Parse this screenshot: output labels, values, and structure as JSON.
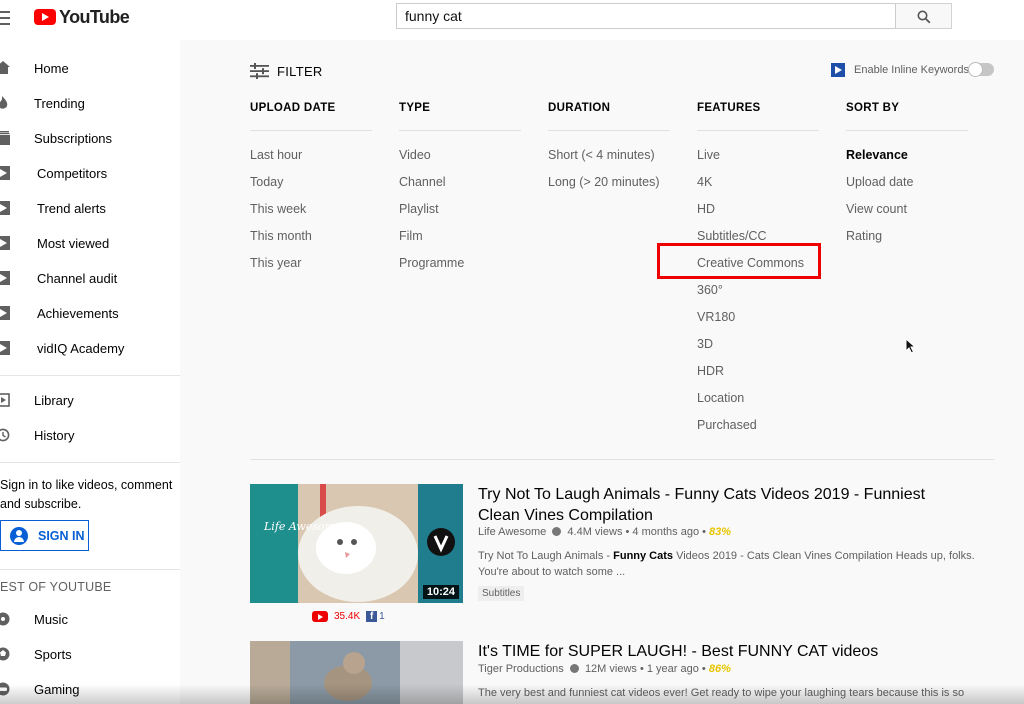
{
  "header": {
    "logo_text": "YouTube",
    "search_value": "funny cat"
  },
  "sidebar": {
    "items": [
      {
        "label": "Home",
        "icon": "home-icon"
      },
      {
        "label": "Trending",
        "icon": "flame-icon"
      },
      {
        "label": "Subscriptions",
        "icon": "subscriptions-icon"
      },
      {
        "label": "Competitors",
        "icon": "vidiq-play-icon"
      },
      {
        "label": "Trend alerts",
        "icon": "vidiq-play-icon"
      },
      {
        "label": "Most viewed",
        "icon": "vidiq-play-icon"
      },
      {
        "label": "Channel audit",
        "icon": "vidiq-play-icon"
      },
      {
        "label": "Achievements",
        "icon": "vidiq-play-icon"
      },
      {
        "label": "vidIQ Academy",
        "icon": "vidiq-play-icon"
      }
    ],
    "secondary": [
      {
        "label": "Library",
        "icon": "library-icon"
      },
      {
        "label": "History",
        "icon": "history-icon"
      }
    ],
    "signin_prompt": "Sign in to like videos, comment and subscribe.",
    "signin_label": "SIGN IN",
    "best_of_title": "EST OF YOUTUBE",
    "best_of": [
      {
        "label": "Music",
        "icon": "music-icon"
      },
      {
        "label": "Sports",
        "icon": "sports-icon"
      },
      {
        "label": "Gaming",
        "icon": "gaming-icon"
      }
    ]
  },
  "filter": {
    "label": "FILTER",
    "inline_keywords_label": "Enable Inline Keywords",
    "inline_keywords_enabled": false,
    "columns": [
      {
        "header": "UPLOAD DATE",
        "options": [
          "Last hour",
          "Today",
          "This week",
          "This month",
          "This year"
        ]
      },
      {
        "header": "TYPE",
        "options": [
          "Video",
          "Channel",
          "Playlist",
          "Film",
          "Programme"
        ]
      },
      {
        "header": "DURATION",
        "options": [
          "Short (< 4 minutes)",
          "Long (> 20 minutes)"
        ]
      },
      {
        "header": "FEATURES",
        "options": [
          "Live",
          "4K",
          "HD",
          "Subtitles/CC",
          "Creative Commons",
          "360°",
          "VR180",
          "3D",
          "HDR",
          "Location",
          "Purchased"
        ]
      },
      {
        "header": "SORT BY",
        "options": [
          "Relevance",
          "Upload date",
          "View count",
          "Rating"
        ],
        "selected": "Relevance"
      }
    ],
    "highlighted_option": "Creative Commons"
  },
  "results": [
    {
      "title_line1": "Try Not To Laugh Animals - Funny Cats Videos 2019 - Funniest",
      "title_line2": "Clean Vines Compilation",
      "channel": "Life Awesome",
      "views": "4.4M views",
      "age": "4 months ago",
      "score": "83%",
      "desc_pre": "Try Not To Laugh Animals - ",
      "desc_bold": "Funny Cats",
      "desc_post": " Videos 2019 - Cats Clean Vines Compilation Heads up, folks.",
      "desc_line2": "You're about to watch some ...",
      "tag": "Subtitles",
      "duration": "10:24",
      "yt_likes": "35.4K",
      "fb_shares": "1",
      "thumb_text": "Life Awesome"
    },
    {
      "title_line1": "It's TIME for SUPER LAUGH! - Best FUNNY CAT videos",
      "channel": "Tiger Productions",
      "views": "12M views",
      "age": "1 year ago",
      "score": "86%",
      "desc_line1": "The very best and funniest cat videos ever! Get ready to wipe your laughing tears because this is so"
    }
  ]
}
